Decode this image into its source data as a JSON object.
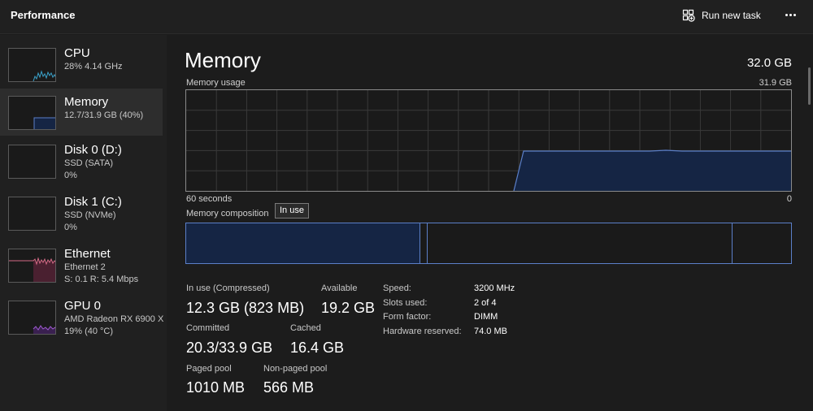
{
  "app": {
    "title": "Performance",
    "run_new_task": "Run new task"
  },
  "colors": {
    "memory_line": "#5b7fc8",
    "memory_fill": "#152544",
    "cpu": "#3aa1c9",
    "ethernet": "#d46a86",
    "gpu": "#a05bd2"
  },
  "sidebar": {
    "items": [
      {
        "name": "CPU",
        "sub1": "28%  4.14 GHz",
        "sub2": ""
      },
      {
        "name": "Memory",
        "sub1": "12.7/31.9 GB (40%)",
        "sub2": ""
      },
      {
        "name": "Disk 0 (D:)",
        "sub1": "SSD (SATA)",
        "sub2": "0%"
      },
      {
        "name": "Disk 1 (C:)",
        "sub1": "SSD (NVMe)",
        "sub2": "0%"
      },
      {
        "name": "Ethernet",
        "sub1": "Ethernet 2",
        "sub2": "S: 0.1  R: 5.4 Mbps"
      },
      {
        "name": "GPU 0",
        "sub1": "AMD Radeon RX 6900 X",
        "sub2": "19%  (40 °C)"
      }
    ]
  },
  "main": {
    "title": "Memory",
    "total": "32.0 GB",
    "usage_label": "Memory usage",
    "usage_max": "31.9 GB",
    "axis_left": "60 seconds",
    "axis_right": "0",
    "composition_label": "Memory composition",
    "tooltip": "In use",
    "stats": {
      "in_use_label": "In use (Compressed)",
      "in_use_value": "12.3 GB (823 MB)",
      "available_label": "Available",
      "available_value": "19.2 GB",
      "committed_label": "Committed",
      "committed_value": "20.3/33.9 GB",
      "cached_label": "Cached",
      "cached_value": "16.4 GB",
      "paged_label": "Paged pool",
      "paged_value": "1010 MB",
      "nonpaged_label": "Non-paged pool",
      "nonpaged_value": "566 MB"
    },
    "details": [
      {
        "key": "Speed:",
        "value": "3200 MHz"
      },
      {
        "key": "Slots used:",
        "value": "2 of 4"
      },
      {
        "key": "Form factor:",
        "value": "DIMM"
      },
      {
        "key": "Hardware reserved:",
        "value": "74.0 MB"
      }
    ]
  }
}
